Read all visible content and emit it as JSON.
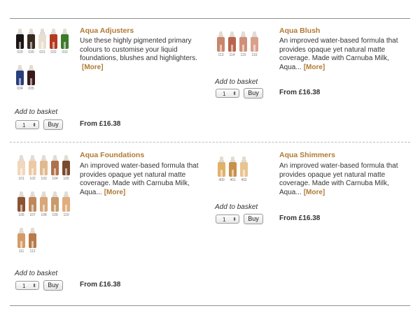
{
  "colors": {
    "accent": "#b07a34",
    "rule": "#8f8f8f"
  },
  "products": [
    {
      "title": "Aqua Adjusters",
      "description": "Use these highly pigmented primary colours to customise your liquid foundations, blushes and highlighters.",
      "more": "[More]",
      "add_label": "Add to basket",
      "qty": "1",
      "buy": "Buy",
      "price": "From £16.38",
      "bottles": [
        {
          "code": "029",
          "color": "#1a1414"
        },
        {
          "code": "030",
          "color": "#3a2a1e"
        },
        {
          "code": "031",
          "color": "#e8dfcf"
        },
        {
          "code": "032",
          "color": "#b33a22"
        },
        {
          "code": "033",
          "color": "#3d7a2c"
        },
        {
          "code": "034",
          "color": "#2a3f7a"
        },
        {
          "code": "035",
          "color": "#3a1a1c"
        }
      ]
    },
    {
      "title": "Aqua Blush",
      "description": "An improved water-based formula that provides opaque yet natural matte coverage. Made with Carnuba Milk, Aqua...",
      "more": "[More]",
      "add_label": "Add to basket",
      "qty": "1",
      "buy": "Buy",
      "price": "From £16.38",
      "bottles": [
        {
          "code": "113",
          "color": "#c9866a"
        },
        {
          "code": "114",
          "color": "#b8654d"
        },
        {
          "code": "115",
          "color": "#d08f78"
        },
        {
          "code": "116",
          "color": "#d9a08c"
        }
      ]
    },
    {
      "title": "Aqua Foundations",
      "description": "An improved water-based formula that provides opaque yet natural matte coverage. Made with Carnuba Milk, Aqua...",
      "more": "[More]",
      "add_label": "Add to basket",
      "qty": "1",
      "buy": "Buy",
      "price": "From £16.38",
      "bottles": [
        {
          "code": "101",
          "color": "#f0d7bd"
        },
        {
          "code": "102",
          "color": "#ecc9a4"
        },
        {
          "code": "103",
          "color": "#e2b98f"
        },
        {
          "code": "104",
          "color": "#b0714a"
        },
        {
          "code": "105",
          "color": "#7a4a2e"
        },
        {
          "code": "106",
          "color": "#8a5434"
        },
        {
          "code": "107",
          "color": "#c0875a"
        },
        {
          "code": "108",
          "color": "#d8a677"
        },
        {
          "code": "109",
          "color": "#c89a6a"
        },
        {
          "code": "110",
          "color": "#e0ad7c"
        },
        {
          "code": "111",
          "color": "#d49b66"
        },
        {
          "code": "112",
          "color": "#b87a48"
        }
      ]
    },
    {
      "title": "Aqua Shimmers",
      "description": "An improved water-based formula that provides opaque yet natural matte coverage. Made with Carnuba Milk, Aqua...",
      "more": "[More]",
      "add_label": "Add to basket",
      "qty": "1",
      "buy": "Buy",
      "price": "From £16.38",
      "bottles": [
        {
          "code": "400",
          "color": "#e0b26a"
        },
        {
          "code": "401",
          "color": "#c9904a"
        },
        {
          "code": "402",
          "color": "#e8c490"
        }
      ]
    }
  ]
}
